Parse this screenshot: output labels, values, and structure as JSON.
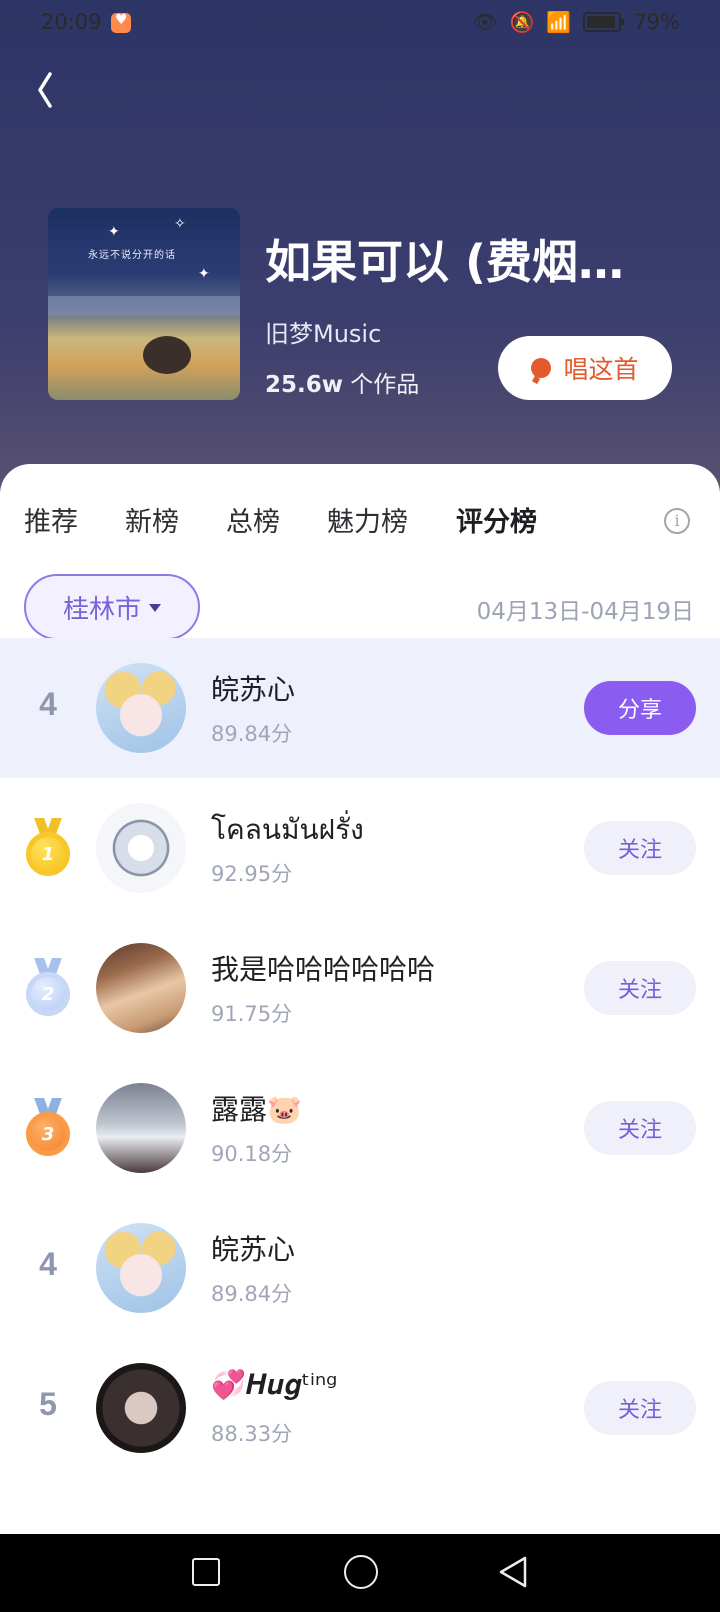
{
  "status_bar": {
    "time": "20:09",
    "battery": "79%"
  },
  "song": {
    "title": "如果可以 (费烟催…",
    "artist": "旧梦Music",
    "works_count": "25.6w",
    "works_suffix": " 个作品",
    "sing_label": "唱这首",
    "cover_text": "永远不说分开的话"
  },
  "tabs": [
    {
      "label": "推荐",
      "active": false
    },
    {
      "label": "新榜",
      "active": false
    },
    {
      "label": "总榜",
      "active": false
    },
    {
      "label": "魅力榜",
      "active": false
    },
    {
      "label": "评分榜",
      "active": true
    }
  ],
  "info_icon": "i",
  "filter": {
    "city": "桂林市",
    "date_range": "04月13日-04月19日"
  },
  "my_rank": {
    "rank": "4",
    "name": "皖苏心",
    "score": "89.84分",
    "action": "分享"
  },
  "ranking": [
    {
      "rank": "1",
      "medal": "gold",
      "name": "โคลนมันฝรั่ง",
      "score": "92.95分",
      "action": "关注"
    },
    {
      "rank": "2",
      "medal": "silver",
      "name": "我是哈哈哈哈哈哈",
      "score": "91.75分",
      "action": "关注"
    },
    {
      "rank": "3",
      "medal": "bronze",
      "name": "露露🐷",
      "score": "90.18分",
      "action": "关注"
    },
    {
      "rank": "4",
      "medal": "",
      "name": "皖苏心",
      "score": "89.84分",
      "action": ""
    },
    {
      "rank": "5",
      "medal": "",
      "name": "💞𝑯𝒖𝒈ᵗⁱⁿᵍ",
      "score": "88.33分",
      "action": "关注"
    }
  ],
  "colors": {
    "accent_purple": "#8b5cf0",
    "sing_orange": "#e35a2d",
    "tab_highlight": "#ffe033"
  }
}
